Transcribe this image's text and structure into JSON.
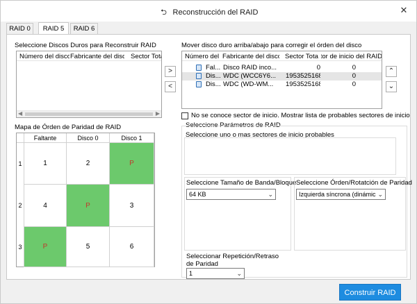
{
  "window": {
    "title": "Reconstrucción del RAID",
    "title_icon": "undo-arrow-icon",
    "close_glyph": "✕"
  },
  "tabs": [
    {
      "label": "RAID 0"
    },
    {
      "label": "RAID 5"
    },
    {
      "label": "RAID 6"
    }
  ],
  "active_tab": "RAID 5",
  "left_list": {
    "label": "Seleccione Discos Duros para Reconstruir RAID",
    "columns": [
      "Número del disco",
      "Fabricante del disco",
      "Sector Total"
    ],
    "rows": []
  },
  "arrows": {
    "right": ">",
    "left": "<",
    "up": "⌃",
    "down": "⌄"
  },
  "right_list": {
    "label": "Mover disco duro arriba/abajo para corregir el órden del disco",
    "columns": [
      "Número del disco",
      "Fabricante del disco",
      "Sector Total",
      "Sector de inicio del RAID"
    ],
    "rows": [
      {
        "num": "Fal...",
        "maker": "Disco RAID inco...",
        "total": "0",
        "start": "0"
      },
      {
        "num": "Dis...",
        "maker": "WDC (WCC6Y6...",
        "total": "1953525168",
        "start": "0"
      },
      {
        "num": "Dis...",
        "maker": "WDC (WD-WM...",
        "total": "1953525168",
        "start": "0"
      }
    ]
  },
  "unknown_start": {
    "label": "No se conoce sector de inicio. Mostrar lista de probables sectores de inicio",
    "checked": false
  },
  "parity_map": {
    "label": "Mapa de Órden de Paridad de RAID",
    "columns": [
      "Faltante",
      "Disco 0",
      "Disco 1"
    ],
    "rows": [
      {
        "num": "1",
        "cells": [
          "1",
          "2",
          "P"
        ]
      },
      {
        "num": "2",
        "cells": [
          "4",
          "P",
          "3"
        ]
      },
      {
        "num": "3",
        "cells": [
          "P",
          "5",
          "6"
        ]
      }
    ],
    "parity_color": "#6cc96c"
  },
  "params": {
    "group_label": "Seleccione Parámetros de RAID",
    "start_sectors_label": "Seleccione uno o mas sectores de inicio probables",
    "stripe_label": "Seleccione Tamaño de Banda/Bloque",
    "stripe_value": "64 KB",
    "rotation_label": "Seleccione Órden/Rotatción de Paridad",
    "rotation_value": "Izquierda síncrona (dinámic",
    "repeat_label_1": "Seleccionar Repetición/Retraso",
    "repeat_label_2": "de Paridad",
    "repeat_value": "1"
  },
  "build_button": {
    "label": "Construir RAID",
    "color": "#1e8ce0"
  }
}
